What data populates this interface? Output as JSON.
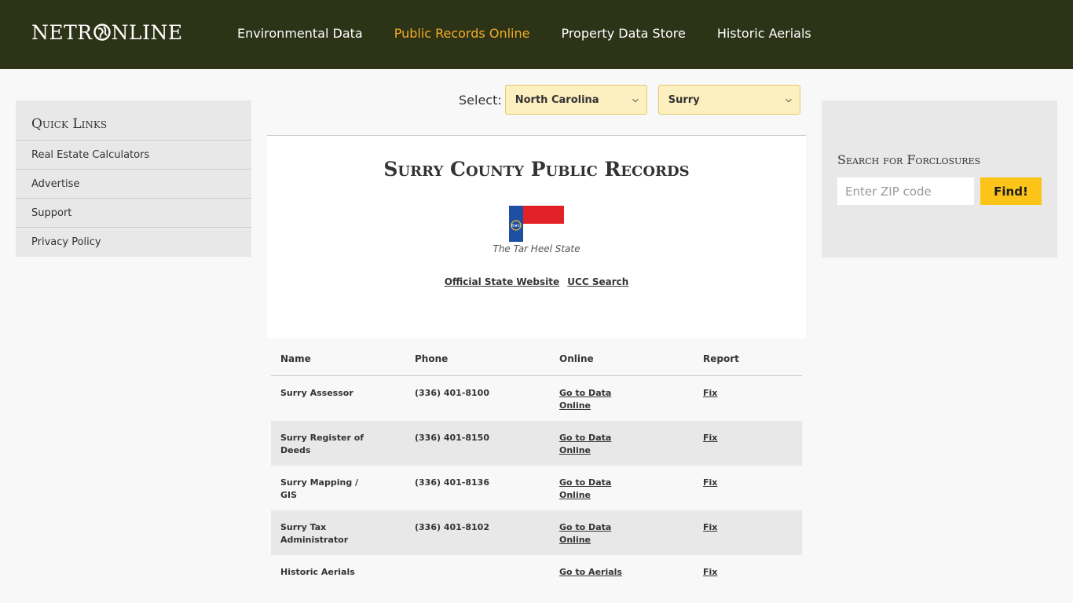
{
  "header": {
    "logo_text_left": "NETR",
    "logo_text_right": "NLINE",
    "nav": [
      {
        "label": "Environmental Data",
        "active": false
      },
      {
        "label": "Public Records Online",
        "active": true
      },
      {
        "label": "Property Data Store",
        "active": false
      },
      {
        "label": "Historic Aerials",
        "active": false
      }
    ]
  },
  "selector": {
    "label": "Select:",
    "state": "North Carolina",
    "county": "Surry"
  },
  "quick_links": {
    "title": "Quick Links",
    "items": [
      "Real Estate Calculators",
      "Advertise",
      "Support",
      "Privacy Policy"
    ]
  },
  "foreclosure": {
    "title": "Search for Forclosures",
    "zip_placeholder": "Enter ZIP code",
    "button": "Find!"
  },
  "main": {
    "title": "Surry County Public Records",
    "motto": "The Tar Heel State",
    "links": [
      "Official State Website",
      "UCC Search"
    ]
  },
  "table": {
    "headers": [
      "Name",
      "Phone",
      "Online",
      "Report"
    ],
    "rows": [
      {
        "name": "Surry Assessor",
        "phone": "(336) 401-8100",
        "online": "Go to Data Online",
        "report": "Fix"
      },
      {
        "name": "Surry Register of Deeds",
        "phone": "(336) 401-8150",
        "online": "Go to Data Online",
        "report": "Fix"
      },
      {
        "name": "Surry Mapping / GIS",
        "phone": "(336) 401-8136",
        "online": "Go to Data Online",
        "report": "Fix"
      },
      {
        "name": "Surry Tax Administrator",
        "phone": "(336) 401-8102",
        "online": "Go to Data Online",
        "report": "Fix"
      },
      {
        "name": "Historic Aerials",
        "phone": "",
        "online": "Go to Aerials",
        "report": "Fix"
      }
    ]
  },
  "colors": {
    "header_bg": "#2c3316",
    "nav_active": "#f2ad2b",
    "select_bg": "#fcefc0",
    "find_button": "#fcc419",
    "flag_blue": "#1f4fa3",
    "flag_red": "#e32227"
  }
}
